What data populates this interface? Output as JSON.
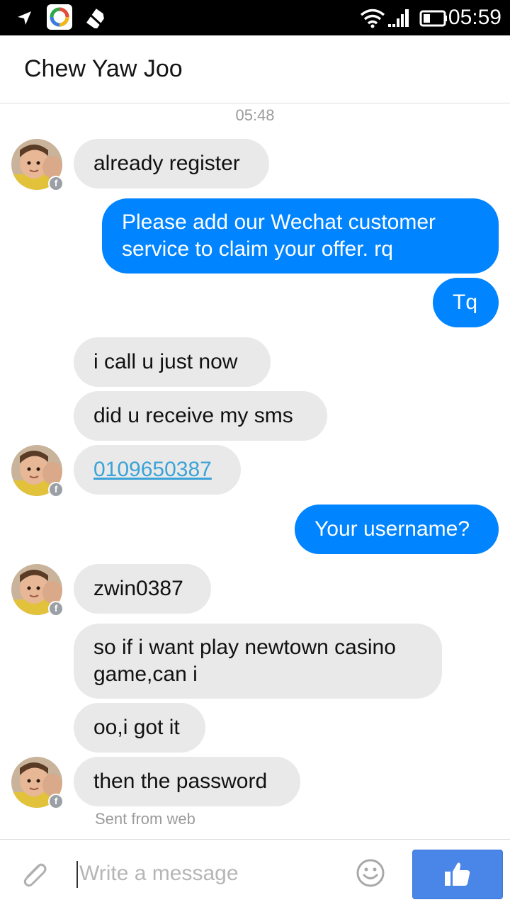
{
  "status_bar": {
    "time": "05:59"
  },
  "header": {
    "title": "Chew Yaw Joo"
  },
  "timestamp": "05:48",
  "messages": [
    {
      "direction": "in",
      "text": "already register"
    },
    {
      "direction": "out",
      "text": "Please add our Wechat customer service to claim your offer. rq"
    },
    {
      "direction": "out",
      "text": "Tq"
    },
    {
      "direction": "in",
      "text": "i call u just now"
    },
    {
      "direction": "in",
      "text": "did u receive my sms"
    },
    {
      "direction": "in",
      "text": "0109650387",
      "link": true
    },
    {
      "direction": "out",
      "text": "Your username?"
    },
    {
      "direction": "in",
      "text": "zwin0387"
    },
    {
      "direction": "in",
      "text": "so if i want play newtown casino game,can i"
    },
    {
      "direction": "in",
      "text": "oo,i got it"
    },
    {
      "direction": "in",
      "text": "then the password"
    }
  ],
  "sent_from": "Sent from web",
  "composer": {
    "placeholder": "Write a message"
  },
  "colors": {
    "outgoing": "#0084ff",
    "incoming": "#e9e9e9",
    "like_button": "#4a86e8"
  },
  "icons": [
    "send-arrow-icon",
    "app-icon",
    "no-sim-icon",
    "wifi-icon",
    "signal-icon",
    "battery-icon",
    "messenger-badge-icon",
    "attach-icon",
    "emoji-icon",
    "thumbs-up-icon"
  ]
}
